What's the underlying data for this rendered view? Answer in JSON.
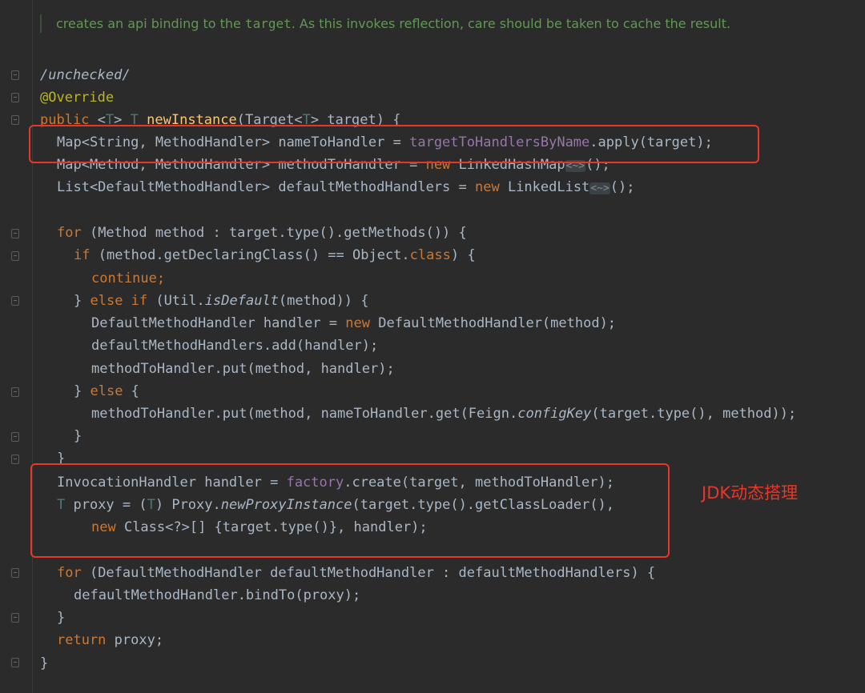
{
  "doc_comment": {
    "text_before": "creates an api binding to the ",
    "code_word": "target",
    "text_after": ". As this invokes reflection, care should be taken to cache the result."
  },
  "code": {
    "unchecked": "/unchecked/",
    "override": "@Override",
    "l_signature": {
      "public": "public ",
      "lt": "<",
      "t1": "T",
      "gt": "> ",
      "t2": "T",
      "sp": " ",
      "method": "newInstance",
      "args": "(Target<",
      "t3": "T",
      "rest": "> target) {"
    },
    "l_map1": {
      "a": "Map<String, MethodHandler> nameToHandler = ",
      "field": "targetToHandlersByName",
      "b": ".apply(target);"
    },
    "l_map2": {
      "a": "Map<Method, MethodHandler> methodToHandler = ",
      "new": "new",
      "b": " LinkedHashMap",
      "fold": "<~>",
      "c": "();"
    },
    "l_list": {
      "a": "List<DefaultMethodHandler> defaultMethodHandlers = ",
      "new": "new",
      "b": " LinkedList",
      "fold": "<~>",
      "c": "();"
    },
    "l_for1": {
      "for": "for",
      "a": " (Method method : target.type().getMethods()) {"
    },
    "l_if": {
      "if": "if",
      "a": " (method.getDeclaringClass() == Object.",
      "class": "class",
      "b": ") {"
    },
    "l_continue": "continue;",
    "l_elseif": {
      "a": "} ",
      "else": "else if",
      "b": " (Util.",
      "method": "isDefault",
      "c": "(method)) {"
    },
    "l_dmh": {
      "a": "DefaultMethodHandler handler = ",
      "new": "new",
      "b": " DefaultMethodHandler(method);"
    },
    "l_add": "defaultMethodHandlers.add(handler);",
    "l_put1": "methodToHandler.put(method, handler);",
    "l_else": {
      "a": "} ",
      "else": "else",
      "b": " {"
    },
    "l_put2": {
      "a": "methodToHandler.put(method, nameToHandler.get(Feign.",
      "method": "configKey",
      "b": "(target.type(), method));"
    },
    "l_close1": "}",
    "l_close2": "}",
    "l_invoc": {
      "a": "InvocationHandler handler = ",
      "field": "factory",
      "b": ".create(target, methodToHandler);"
    },
    "l_proxy": {
      "t": "T",
      "a": " proxy = (",
      "t2": "T",
      "b": ") Proxy.",
      "method": "newProxyInstance",
      "c": "(target.type().getClassLoader(),"
    },
    "l_newclass": {
      "new": "new",
      "a": " Class<?>[] {target.type()}, handler);"
    },
    "l_for2": {
      "for": "for",
      "a": " (DefaultMethodHandler defaultMethodHandler : defaultMethodHandlers) {"
    },
    "l_bind": "defaultMethodHandler.bindTo(proxy);",
    "l_close3": "}",
    "l_return": {
      "return": "return",
      "a": " proxy;"
    },
    "l_close4": "}"
  },
  "annotation_label": "JDK动态搭理",
  "colors": {
    "highlight_box": "#e8362a",
    "background": "#2b2b2b"
  }
}
